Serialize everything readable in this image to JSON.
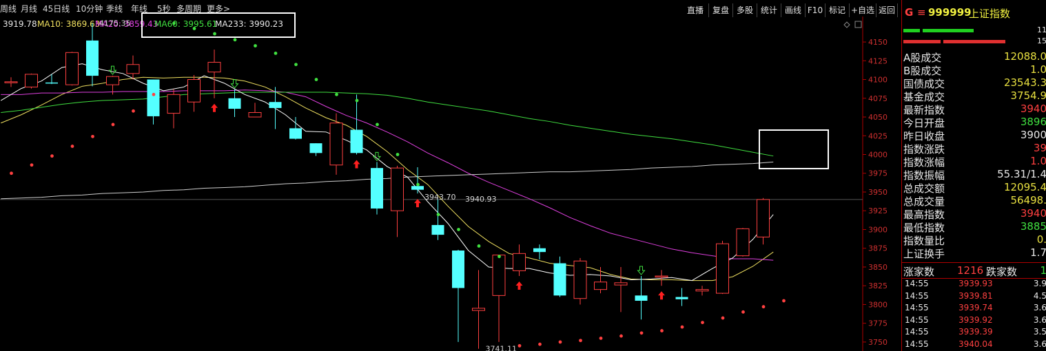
{
  "periods": [
    "周线",
    "月线",
    "45日线",
    "10分钟",
    "季线",
    "年线",
    "5秒",
    "多周期",
    "更多>"
  ],
  "toolbar": [
    "直播",
    "复盘",
    "多股",
    "统计",
    "画线",
    "F10",
    "标记",
    "+自选",
    "返回"
  ],
  "ma_legend": [
    {
      "text": "3919.78",
      "color": "#e8e8e8"
    },
    {
      "text": "MA10: 3869.63",
      "color": "#f0e060"
    },
    {
      "text": "MA20: 3859.43",
      "color": "#e040e0"
    },
    {
      "text": "MA60: 3995.61",
      "color": "#40e040"
    },
    {
      "text": "MA233: 3990.23",
      "color": "#e8e8e8"
    }
  ],
  "chart_data": {
    "type": "candlestick",
    "y_ticks": [
      4150,
      4125,
      4100,
      4075,
      4050,
      4025,
      4000,
      3975,
      3950,
      3925,
      3900,
      3875,
      3850,
      3825,
      3800,
      3775,
      3750
    ],
    "ylim": [
      3738,
      4184
    ],
    "annotations": [
      {
        "text": "4175.35",
        "price": 4175.35,
        "candle": 4
      },
      {
        "text": "3943.70",
        "price": 3943.7,
        "candle": 20
      },
      {
        "text": "3940.93",
        "price": 3940.93,
        "candle": 22
      },
      {
        "text": "3741.11",
        "price": 3741.11,
        "candle": 23
      }
    ],
    "candles": [
      {
        "o": 4097,
        "c": 4097,
        "h": 4103,
        "l": 4090
      },
      {
        "o": 4090,
        "c": 4107,
        "h": 4108,
        "l": 4088
      },
      {
        "o": 4096,
        "c": 4095,
        "h": 4107,
        "l": 4094
      },
      {
        "o": 4093,
        "c": 4136,
        "h": 4137,
        "l": 4092
      },
      {
        "o": 4152,
        "c": 4105,
        "h": 4175,
        "l": 4091
      },
      {
        "o": 4093,
        "c": 4104,
        "h": 4105,
        "l": 4080
      },
      {
        "o": 4108,
        "c": 4120,
        "h": 4132,
        "l": 4100
      },
      {
        "o": 4100,
        "c": 4051,
        "h": 4100,
        "l": 4040
      },
      {
        "o": 4055,
        "c": 4080,
        "h": 4087,
        "l": 4035
      },
      {
        "o": 4070,
        "c": 4100,
        "h": 4106,
        "l": 4057
      },
      {
        "o": 4110,
        "c": 4123,
        "h": 4140,
        "l": 4075
      },
      {
        "o": 4075,
        "c": 4061,
        "h": 4087,
        "l": 4050
      },
      {
        "o": 4050,
        "c": 4056,
        "h": 4069,
        "l": 4050
      },
      {
        "o": 4070,
        "c": 4062,
        "h": 4090,
        "l": 4034
      },
      {
        "o": 4035,
        "c": 4021,
        "h": 4050,
        "l": 4020
      },
      {
        "o": 4015,
        "c": 4002,
        "h": 4015,
        "l": 3998
      },
      {
        "o": 3986,
        "c": 4042,
        "h": 4055,
        "l": 3973
      },
      {
        "o": 4033,
        "c": 4002,
        "h": 4080,
        "l": 4000
      },
      {
        "o": 3982,
        "c": 3928,
        "h": 3990,
        "l": 3920
      },
      {
        "o": 3925,
        "c": 3982,
        "h": 3985,
        "l": 3890
      },
      {
        "o": 3958,
        "c": 3953,
        "h": 3983,
        "l": 3948
      },
      {
        "o": 3906,
        "c": 3893,
        "h": 3940,
        "l": 3886
      },
      {
        "o": 3872,
        "c": 3822,
        "h": 3873,
        "l": 3750
      },
      {
        "o": 3792,
        "c": 3795,
        "h": 3846,
        "l": 3741
      },
      {
        "o": 3812,
        "c": 3866,
        "h": 3866,
        "l": 3750
      },
      {
        "o": 3845,
        "c": 3868,
        "h": 3880,
        "l": 3838
      },
      {
        "o": 3875,
        "c": 3870,
        "h": 3880,
        "l": 3860
      },
      {
        "o": 3855,
        "c": 3812,
        "h": 3864,
        "l": 3810
      },
      {
        "o": 3808,
        "c": 3858,
        "h": 3862,
        "l": 3800
      },
      {
        "o": 3820,
        "c": 3830,
        "h": 3850,
        "l": 3815
      },
      {
        "o": 3826,
        "c": 3829,
        "h": 3850,
        "l": 3790
      },
      {
        "o": 3812,
        "c": 3805,
        "h": 3838,
        "l": 3780
      },
      {
        "o": 3837,
        "c": 3838,
        "h": 3846,
        "l": 3825
      },
      {
        "o": 3810,
        "c": 3807,
        "h": 3822,
        "l": 3798
      },
      {
        "o": 3818,
        "c": 3820,
        "h": 3825,
        "l": 3812
      },
      {
        "o": 3815,
        "c": 3881,
        "h": 3885,
        "l": 3814
      },
      {
        "o": 3865,
        "c": 3901,
        "h": 3902,
        "l": 3864
      },
      {
        "o": 3890,
        "c": 3940,
        "h": 3942,
        "l": 3880
      }
    ],
    "series": [
      {
        "name": "MA10",
        "color": "#f0e060",
        "values": [
          4042,
          4053,
          4066,
          4080,
          4091,
          4095,
          4100,
          4103,
          4102,
          4103,
          4103,
          4102,
          4098,
          4090,
          4077,
          4062,
          4049,
          4039,
          4024,
          4004,
          3980,
          3960,
          3931,
          3904,
          3884,
          3868,
          3862,
          3855,
          3852,
          3849,
          3840,
          3834,
          3833,
          3833,
          3832,
          3832,
          3837,
          3851,
          3870
        ]
      },
      {
        "name": "MA20",
        "color": "#e040e0",
        "values": [
          4080,
          4080,
          4082,
          4082,
          4083,
          4083,
          4084,
          4084,
          4084,
          4085,
          4085,
          4085,
          4086,
          4085,
          4083,
          4077,
          4064,
          4052,
          4042,
          4030,
          4017,
          4002,
          3989,
          3975,
          3963,
          3952,
          3941,
          3929,
          3916,
          3905,
          3895,
          3888,
          3881,
          3874,
          3869,
          3865,
          3861,
          3861,
          3859
        ]
      },
      {
        "name": "MA60",
        "color": "#40e040",
        "values": [
          4056,
          4059,
          4063,
          4067,
          4070,
          4072,
          4073,
          4074,
          4077,
          4080,
          4081,
          4082,
          4083,
          4083,
          4083,
          4083,
          4083,
          4082,
          4081,
          4079,
          4075,
          4070,
          4066,
          4062,
          4058,
          4053,
          4048,
          4044,
          4039,
          4035,
          4031,
          4027,
          4024,
          4021,
          4017,
          4013,
          4008,
          4003,
          3998
        ]
      },
      {
        "name": "MA233",
        "color": "#d0d0d0",
        "values": [
          3941,
          3942,
          3943,
          3945,
          3946,
          3948,
          3949,
          3950,
          3952,
          3953,
          3955,
          3956,
          3957,
          3959,
          3961,
          3962,
          3964,
          3965,
          3967,
          3968,
          3970,
          3971,
          3972,
          3973,
          3974,
          3975,
          3976,
          3977,
          3977,
          3978,
          3979,
          3980,
          3982,
          3983,
          3984,
          3986,
          3987,
          3988,
          3990
        ]
      },
      {
        "name": "MA5",
        "color": "#ffffff",
        "values": [
          4072,
          4088,
          4098,
          4116,
          4121,
          4113,
          4108,
          4095,
          4085,
          4090,
          4105,
          4095,
          4080,
          4070,
          4053,
          4031,
          4030,
          4019,
          4006,
          3984,
          3970,
          3937,
          3908,
          3872,
          3850,
          3848,
          3848,
          3842,
          3839,
          3840,
          3838,
          3833,
          3834,
          3836,
          3832,
          3848,
          3862,
          3887,
          3920
        ]
      }
    ],
    "sar_dots": [
      {
        "price": 3975,
        "color": "#ff4040"
      },
      {
        "price": 3986,
        "color": "#ff4040"
      },
      {
        "price": 3998,
        "color": "#ff4040"
      },
      {
        "price": 4011,
        "color": "#ff4040"
      },
      {
        "price": 4024,
        "color": "#ff4040"
      },
      {
        "price": 4040,
        "color": "#ff4040"
      },
      {
        "price": 4058,
        "color": "#ff4040"
      },
      {
        "price": 4080,
        "color": "#ff4040"
      },
      {
        "price": 4175,
        "color": "#40e040"
      },
      {
        "price": 4168,
        "color": "#40e040"
      },
      {
        "price": 4161,
        "color": "#40e040"
      },
      {
        "price": 4153,
        "color": "#40e040"
      },
      {
        "price": 4145,
        "color": "#40e040"
      },
      {
        "price": 4135,
        "color": "#40e040"
      },
      {
        "price": 4120,
        "color": "#40e040"
      },
      {
        "price": 4100,
        "color": "#40e040"
      },
      {
        "price": 4080,
        "color": "#40e040"
      },
      {
        "price": 4072,
        "color": "#40e040"
      },
      {
        "price": 4040,
        "color": "#40e040"
      },
      {
        "price": 4000,
        "color": "#40e040"
      },
      {
        "price": 3960,
        "color": "#40e040"
      },
      {
        "price": 3920,
        "color": "#40e040"
      },
      {
        "price": 3900,
        "color": "#40e040"
      },
      {
        "price": 3878,
        "color": "#40e040"
      },
      {
        "price": 3864,
        "color": "#40e040"
      },
      {
        "price": 3745,
        "color": "#ff4040"
      },
      {
        "price": 3747,
        "color": "#ff4040"
      },
      {
        "price": 3750,
        "color": "#ff4040"
      },
      {
        "price": 3752,
        "color": "#ff4040"
      },
      {
        "price": 3755,
        "color": "#ff4040"
      },
      {
        "price": 3758,
        "color": "#ff4040"
      },
      {
        "price": 3762,
        "color": "#ff4040"
      },
      {
        "price": 3765,
        "color": "#ff4040"
      },
      {
        "price": 3770,
        "color": "#ff4040"
      },
      {
        "price": 3776,
        "color": "#ff4040"
      },
      {
        "price": 3782,
        "color": "#ff4040"
      },
      {
        "price": 3790,
        "color": "#ff4040"
      },
      {
        "price": 3797,
        "color": "#ff4040"
      },
      {
        "price": 3805,
        "color": "#ff4040"
      }
    ],
    "signals": [
      {
        "candle": 5,
        "type": "down"
      },
      {
        "candle": 10,
        "type": "up"
      },
      {
        "candle": 11,
        "type": "down"
      },
      {
        "candle": 17,
        "type": "up"
      },
      {
        "candle": 18,
        "type": "down"
      },
      {
        "candle": 20,
        "type": "up"
      },
      {
        "candle": 25,
        "type": "up"
      },
      {
        "candle": 31,
        "type": "down"
      },
      {
        "candle": 32,
        "type": "up"
      }
    ]
  },
  "side": {
    "code": "999999",
    "name": "上证指数",
    "g_label": "G",
    "bar_up": "11",
    "bar_down": "15",
    "rows": [
      {
        "label": "A股成交",
        "value": "12088.0",
        "color": "#e8e040"
      },
      {
        "label": "B股成交",
        "value": "1.0",
        "color": "#e8e040"
      },
      {
        "label": "国债成交",
        "value": "23543.3",
        "color": "#e8e040"
      },
      {
        "label": "基金成交",
        "value": "3754.9",
        "color": "#e8e040"
      },
      {
        "label": "最新指数",
        "value": "3940",
        "color": "#ff4040"
      },
      {
        "label": "今日开盘",
        "value": "3896",
        "color": "#40e040"
      },
      {
        "label": "昨日收盘",
        "value": "3900",
        "color": "#e8e8e8"
      },
      {
        "label": "指数涨跌",
        "value": "39",
        "color": "#ff4040"
      },
      {
        "label": "指数涨幅",
        "value": "1.0",
        "color": "#ff4040"
      },
      {
        "label": "指数振幅",
        "value": "55.31/1.4",
        "color": "#e8e8e8"
      },
      {
        "label": "总成交额",
        "value": "12095.4",
        "color": "#e8e040"
      },
      {
        "label": "总成交量",
        "value": "56498.",
        "color": "#e8e040"
      },
      {
        "label": "最高指数",
        "value": "3940",
        "color": "#ff4040"
      },
      {
        "label": "最低指数",
        "value": "3885",
        "color": "#40e040"
      },
      {
        "label": "指数量比",
        "value": "0.",
        "color": "#e8e040"
      },
      {
        "label": "上证换手",
        "value": "1.7",
        "color": "#e8e8e8"
      }
    ],
    "breadth": {
      "up_label": "涨家数",
      "up": "1216",
      "down_label": "跌家数",
      "down": "1"
    },
    "ticks": [
      {
        "time": "14:55",
        "price": "3939.93",
        "vol": "3.9"
      },
      {
        "time": "14:55",
        "price": "3939.81",
        "vol": "4.5"
      },
      {
        "time": "14:55",
        "price": "3939.74",
        "vol": "3.6"
      },
      {
        "time": "14:55",
        "price": "3939.92",
        "vol": "3.6"
      },
      {
        "time": "14:55",
        "price": "3939.39",
        "vol": "3.5"
      },
      {
        "time": "14:55",
        "price": "3940.04",
        "vol": "3.6"
      }
    ]
  }
}
